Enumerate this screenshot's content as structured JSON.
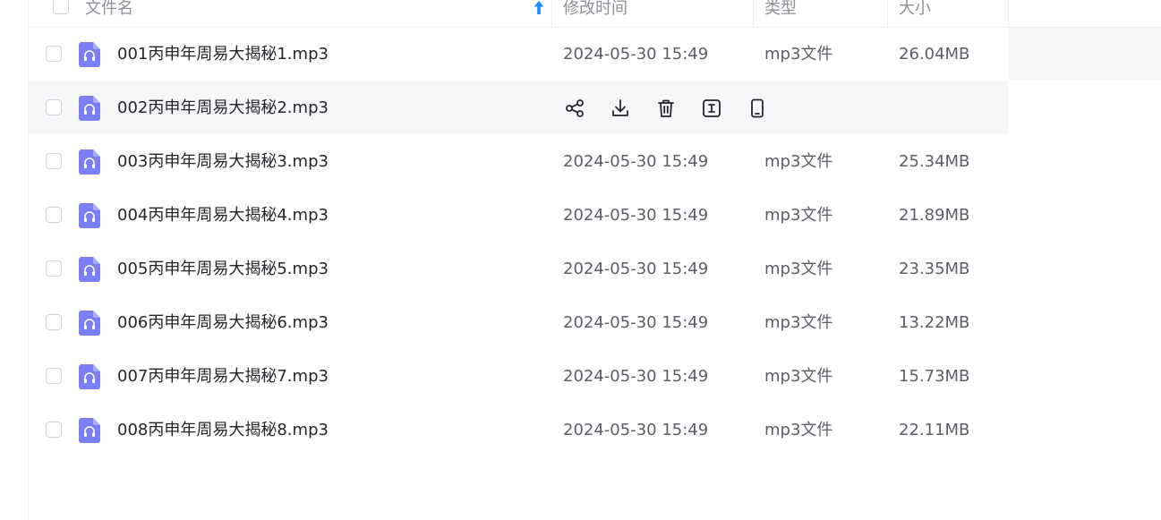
{
  "header": {
    "name_label": "文件名",
    "time_label": "修改时间",
    "type_label": "类型",
    "size_label": "大小",
    "sort_icon": "arrow-up-icon",
    "accent_color": "#1a8cff"
  },
  "icon_color": "#7b7ff5",
  "files": [
    {
      "name": "001丙申年周易大揭秘1.mp3",
      "time": "2024-05-30 15:49",
      "type": "mp3文件",
      "size": "26.04MB"
    },
    {
      "name": "002丙申年周易大揭秘2.mp3",
      "time": "",
      "type": "",
      "size": ""
    },
    {
      "name": "003丙申年周易大揭秘3.mp3",
      "time": "2024-05-30 15:49",
      "type": "mp3文件",
      "size": "25.34MB"
    },
    {
      "name": "004丙申年周易大揭秘4.mp3",
      "time": "2024-05-30 15:49",
      "type": "mp3文件",
      "size": "21.89MB"
    },
    {
      "name": "005丙申年周易大揭秘5.mp3",
      "time": "2024-05-30 15:49",
      "type": "mp3文件",
      "size": "23.35MB"
    },
    {
      "name": "006丙申年周易大揭秘6.mp3",
      "time": "2024-05-30 15:49",
      "type": "mp3文件",
      "size": "13.22MB"
    },
    {
      "name": "007丙申年周易大揭秘7.mp3",
      "time": "2024-05-30 15:49",
      "type": "mp3文件",
      "size": "15.73MB"
    },
    {
      "name": "008丙申年周易大揭秘8.mp3",
      "time": "2024-05-30 15:49",
      "type": "mp3文件",
      "size": "22.11MB"
    }
  ],
  "row_actions": [
    "share-icon",
    "download-icon",
    "delete-icon",
    "rename-icon",
    "send-to-phone-icon"
  ]
}
